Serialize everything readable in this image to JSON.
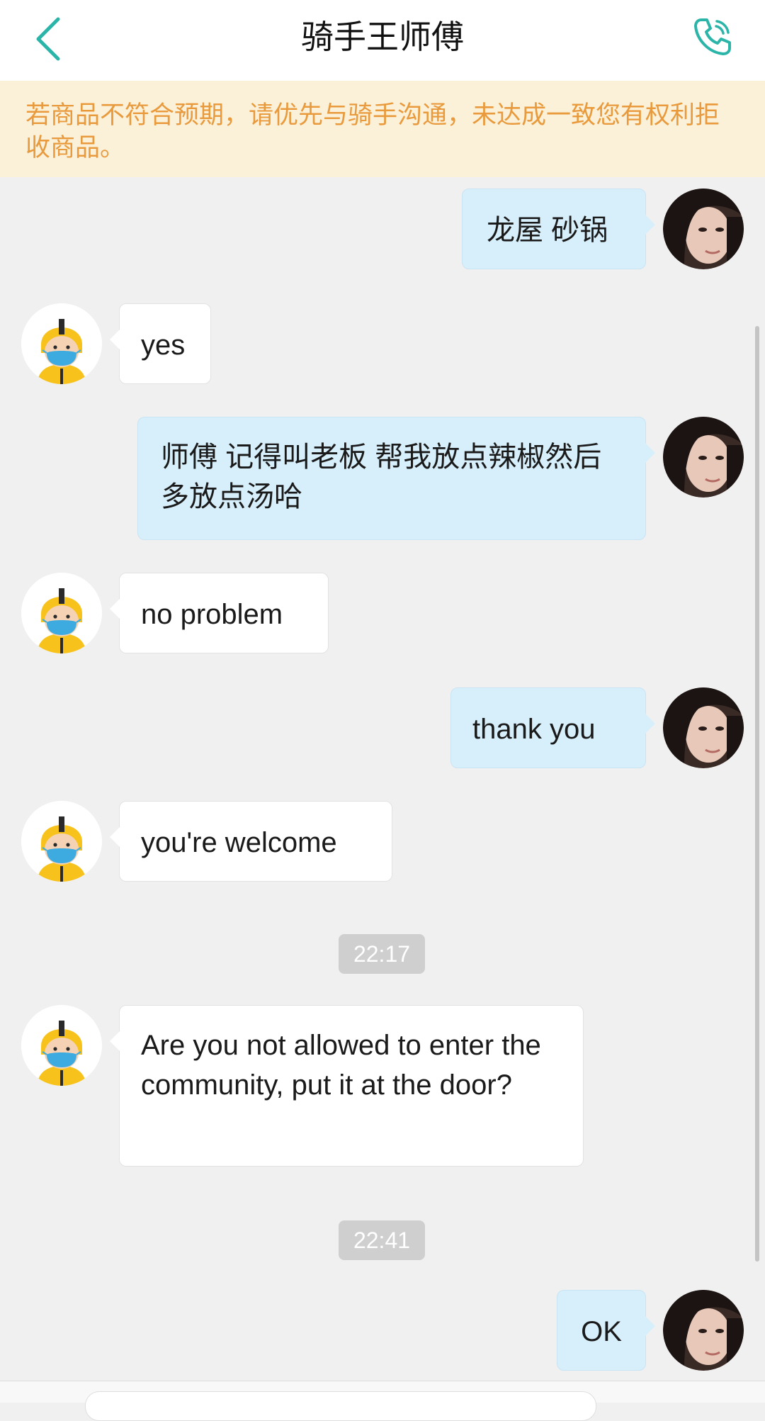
{
  "header": {
    "title": "骑手王师傅",
    "back_icon": "chevron-left-icon",
    "call_icon": "phone-icon",
    "accent_color": "#2bb5a9"
  },
  "notice": {
    "text": "若商品不符合预期，请优先与骑手沟通，未达成一致您有权利拒收商品。"
  },
  "messages": [
    {
      "from": "user",
      "text": "龙屋 砂锅"
    },
    {
      "from": "rider",
      "text": "yes"
    },
    {
      "from": "user",
      "text": "师傅 记得叫老板 帮我放点辣椒然后多放点汤哈"
    },
    {
      "from": "rider",
      "text": "no problem"
    },
    {
      "from": "user",
      "text": "thank you"
    },
    {
      "from": "rider",
      "text": "you're welcome"
    },
    {
      "type": "time",
      "text": "22:17"
    },
    {
      "from": "rider",
      "text": "Are you not allowed to enter the community, put it at the door?"
    },
    {
      "type": "time",
      "text": "22:41"
    },
    {
      "from": "user",
      "text": "OK"
    }
  ],
  "colors": {
    "background": "#f0f0f0",
    "notice_bg": "#fbf0d8",
    "notice_text": "#e89a3c",
    "outgoing_bubble": "#d7effb",
    "incoming_bubble": "#ffffff",
    "time_chip": "#cfcfcf"
  }
}
